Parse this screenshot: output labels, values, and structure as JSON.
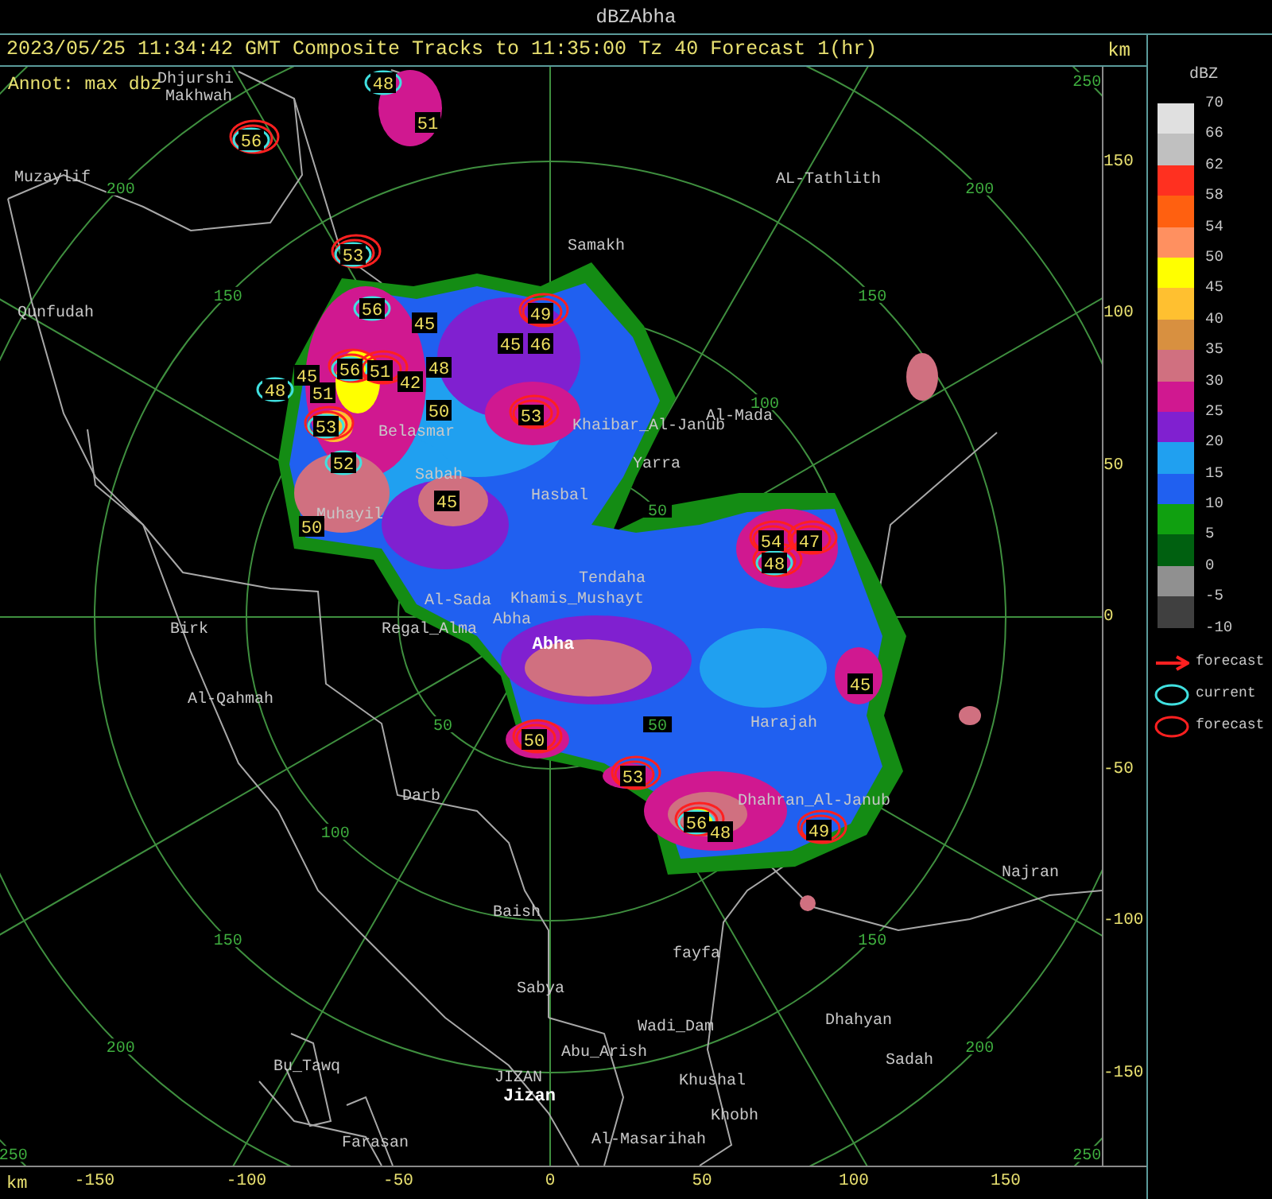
{
  "window": {
    "title": "dBZAbha"
  },
  "header": {
    "text": "2023/05/25 11:34:42 GMT Composite Tracks to 11:35:00 Tz 40 Forecast 1(hr)",
    "unit": "km"
  },
  "annotation": "Annot: max dbz",
  "rings": [
    {
      "ne": "50",
      "sw": "50",
      "se": "50"
    },
    {
      "ne": "100",
      "sw": "100"
    },
    {
      "ne": "150",
      "nw": "150",
      "sw": "150",
      "se": "150"
    },
    {
      "ne": "200",
      "nw": "200",
      "sw": "200",
      "se": "200"
    },
    {
      "ne": "250",
      "sw": "250",
      "se": "250"
    }
  ],
  "places": [
    {
      "name": "Dhjurshi",
      "major": false
    },
    {
      "name": "Makhwah",
      "major": false
    },
    {
      "name": "Muzaylif",
      "major": false
    },
    {
      "name": "AL-Tathlith",
      "major": false
    },
    {
      "name": "Samakh",
      "major": false
    },
    {
      "name": "Qunfudah",
      "major": false
    },
    {
      "name": "Al-Mada",
      "major": false
    },
    {
      "name": "Khaibar_Al-Janub",
      "major": false
    },
    {
      "name": "Belasmar",
      "major": false
    },
    {
      "name": "Yarra",
      "major": false
    },
    {
      "name": "Sabah",
      "major": false
    },
    {
      "name": "Hasbal",
      "major": false
    },
    {
      "name": "Muhayil",
      "major": false
    },
    {
      "name": "Tendaha",
      "major": false
    },
    {
      "name": "Al-Sada",
      "major": false
    },
    {
      "name": "Khamis_Mushayt",
      "major": false
    },
    {
      "name": "Birk",
      "major": false
    },
    {
      "name": "Regal_Alma",
      "major": false
    },
    {
      "name": "Abha",
      "major": false
    },
    {
      "name": "Abha",
      "major": true
    },
    {
      "name": "Al-Qahmah",
      "major": false
    },
    {
      "name": "Harajah",
      "major": false
    },
    {
      "name": "Darb",
      "major": false
    },
    {
      "name": "Dhahran_Al-Janub",
      "major": false
    },
    {
      "name": "Najran",
      "major": false
    },
    {
      "name": "Baish",
      "major": false
    },
    {
      "name": "fayfa",
      "major": false
    },
    {
      "name": "Sabya",
      "major": false
    },
    {
      "name": "Wadi_Dam",
      "major": false
    },
    {
      "name": "Dhahyan",
      "major": false
    },
    {
      "name": "Bu_Tawq",
      "major": false
    },
    {
      "name": "Abu_Arish",
      "major": false
    },
    {
      "name": "Sadah",
      "major": false
    },
    {
      "name": "JIZAN",
      "major": false
    },
    {
      "name": "Khushal",
      "major": false
    },
    {
      "name": "Jizan",
      "major": true
    },
    {
      "name": "Khobh",
      "major": false
    },
    {
      "name": "Farasan",
      "major": false
    },
    {
      "name": "Al-Masarihah",
      "major": false
    }
  ],
  "cells": [
    {
      "value": "48",
      "current": true,
      "forecast": false
    },
    {
      "value": "51",
      "current": false,
      "forecast": false
    },
    {
      "value": "56",
      "current": true,
      "forecast": true
    },
    {
      "value": "53",
      "current": true,
      "forecast": true
    },
    {
      "value": "56",
      "current": true,
      "forecast": false
    },
    {
      "value": "45",
      "current": false,
      "forecast": false
    },
    {
      "value": "49",
      "current": false,
      "forecast": true
    },
    {
      "value": "45",
      "current": false,
      "forecast": false
    },
    {
      "value": "46",
      "current": false,
      "forecast": false
    },
    {
      "value": "56",
      "current": true,
      "forecast": true
    },
    {
      "value": "51",
      "current": false,
      "forecast": true
    },
    {
      "value": "42",
      "current": false,
      "forecast": false
    },
    {
      "value": "48",
      "current": false,
      "forecast": false
    },
    {
      "value": "45",
      "current": false,
      "forecast": false
    },
    {
      "value": "48",
      "current": true,
      "forecast": false
    },
    {
      "value": "51",
      "current": false,
      "forecast": false
    },
    {
      "value": "53",
      "current": true,
      "forecast": true
    },
    {
      "value": "50",
      "current": false,
      "forecast": false
    },
    {
      "value": "53",
      "current": false,
      "forecast": true
    },
    {
      "value": "52",
      "current": true,
      "forecast": false
    },
    {
      "value": "45",
      "current": false,
      "forecast": false
    },
    {
      "value": "50",
      "current": false,
      "forecast": false
    },
    {
      "value": "54",
      "current": false,
      "forecast": true
    },
    {
      "value": "47",
      "current": false,
      "forecast": true
    },
    {
      "value": "48",
      "current": true,
      "forecast": true
    },
    {
      "value": "45",
      "current": false,
      "forecast": false
    },
    {
      "value": "50",
      "current": false,
      "forecast": true
    },
    {
      "value": "53",
      "current": false,
      "forecast": true
    },
    {
      "value": "56",
      "current": true,
      "forecast": true
    },
    {
      "value": "48",
      "current": false,
      "forecast": false
    },
    {
      "value": "49",
      "current": false,
      "forecast": true
    }
  ],
  "y_axis": {
    "ticks": [
      "150",
      "100",
      "50",
      "0",
      "-50",
      "-100",
      "-150"
    ]
  },
  "x_axis": {
    "unit": "km",
    "ticks": [
      "-150",
      "-100",
      "-50",
      "0",
      "50",
      "100",
      "150"
    ]
  },
  "legend": {
    "title": "dBZ",
    "scale": [
      {
        "label": "70",
        "color": "#e0e0e0"
      },
      {
        "label": "66",
        "color": "#c0c0c0"
      },
      {
        "label": "62",
        "color": "#ff3020"
      },
      {
        "label": "58",
        "color": "#ff6010"
      },
      {
        "label": "54",
        "color": "#ff9060"
      },
      {
        "label": "50",
        "color": "#ffff00"
      },
      {
        "label": "45",
        "color": "#ffc030"
      },
      {
        "label": "40",
        "color": "#d89040"
      },
      {
        "label": "35",
        "color": "#d07080"
      },
      {
        "label": "30",
        "color": "#d01890"
      },
      {
        "label": "25",
        "color": "#8020d0"
      },
      {
        "label": "20",
        "color": "#20a0f0"
      },
      {
        "label": "15",
        "color": "#2060f0"
      },
      {
        "label": "10",
        "color": "#10a010"
      },
      {
        "label": "5",
        "color": "#006010"
      },
      {
        "label": "0",
        "color": "#909090"
      },
      {
        "label": "-5",
        "color": "#404040"
      }
    ],
    "scale_end": "-10",
    "keys": [
      {
        "kind": "arrow",
        "label": "forecast"
      },
      {
        "kind": "current",
        "label": "current"
      },
      {
        "kind": "ellipse",
        "label": "forecast"
      }
    ]
  }
}
